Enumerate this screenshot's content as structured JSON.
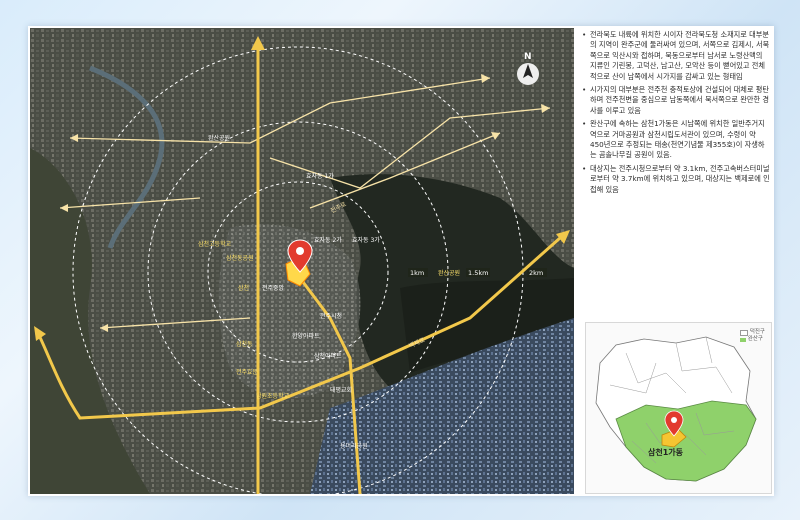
{
  "map": {
    "north_label": "N",
    "ring_labels": [
      "1km",
      "1.5km",
      "2km"
    ],
    "road_labels": [
      "전주로",
      "백제로"
    ],
    "place_labels": [
      "완산공원",
      "삼천고등학교",
      "삼천동공원",
      "효자동 1가",
      "효자동 2가",
      "효자동 3가",
      "삼천",
      "전주중앙",
      "완산공원",
      "전주시청",
      "삼천동",
      "전주효문",
      "한양아파트",
      "삼천아파트",
      "태평교회",
      "남원초등학교",
      "용머리공원"
    ],
    "colors": {
      "roads": "#f2c84b",
      "rings": "#ffffff",
      "arrows": "#f7e3a8",
      "site": "#ffd84a",
      "marker": "#e23b2e"
    }
  },
  "description": {
    "bullets": [
      "전라북도 내륙에 위치한 시이자 전라북도청 소재지로 대부분의 지역이 완주군에 둘러싸여 있으며, 서쪽으로 김제시, 서북쪽으로 익산시와 접하며, 북동으로부터 남서로 노령산맥의 지류인 기린봉, 고덕산, 남고산, 모악산 등이 뻗어있고 전체적으로 산이 남쪽에서 시가지를 감싸고 있는 형태임",
      "시가지의 대부분은 전주천 충적토상에 건설되어 대체로 평탄하며 전주천변을 중심으로 남동쪽에서 북서쪽으로 완만한 경사를 이루고 있음",
      "완산구에 속하는 삼천1가동은 시남쪽에 위치한 일반주거지역으로 거마공원과 삼천시립도서관이 있으며, 수령이 약 450년으로 추정되는 태송(천연기념물 제355호)이 자생하는 곰솔나무길 공원이 있음.",
      "대상지는 전주시청으로부터 약 3.1km, 전주고속버스터미널로부터 약 3.7km에 위치하고 있으며, 대상지는 백제로에 인접해 있음"
    ]
  },
  "inset": {
    "legend": [
      "덕진구",
      "완산구"
    ],
    "site_label": "삼천1가동",
    "colors": {
      "north": "#ffffff",
      "south": "#8fd16b",
      "site": "#f5c531",
      "marker": "#e23b2e"
    }
  }
}
